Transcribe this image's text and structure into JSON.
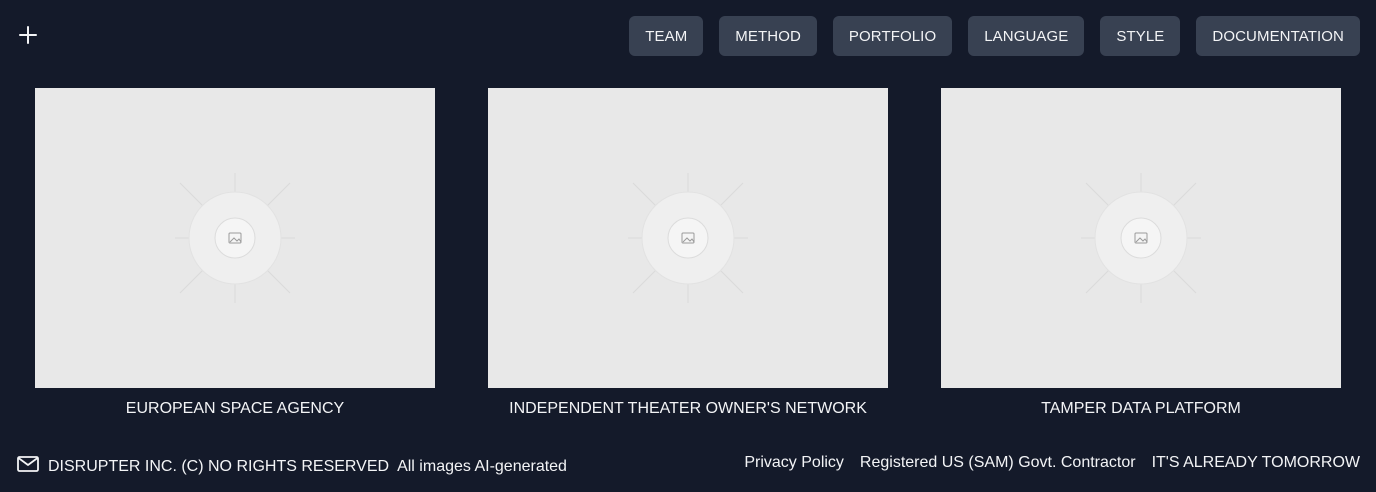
{
  "header": {
    "add_icon": "plus-icon",
    "nav": [
      {
        "label": "TEAM"
      },
      {
        "label": "METHOD"
      },
      {
        "label": "PORTFOLIO"
      },
      {
        "label": "LANGUAGE"
      },
      {
        "label": "STYLE"
      },
      {
        "label": "DOCUMENTATION"
      }
    ]
  },
  "portfolio": {
    "items": [
      {
        "caption": "EUROPEAN SPACE AGENCY",
        "image_icon": "image-placeholder-icon"
      },
      {
        "caption": "INDEPENDENT THEATER OWNER'S NETWORK",
        "image_icon": "image-placeholder-icon"
      },
      {
        "caption": "TAMPER DATA PLATFORM",
        "image_icon": "image-placeholder-icon"
      }
    ]
  },
  "footer": {
    "mail_icon": "mail-icon",
    "copyright": "DISRUPTER INC. (C) NO RIGHTS RESERVED",
    "ai_note": "All images AI-generated",
    "links": [
      {
        "label": "Privacy Policy"
      },
      {
        "label": "Registered US (SAM) Govt. Contractor"
      },
      {
        "label": "IT'S ALREADY TOMORROW"
      }
    ]
  },
  "colors": {
    "background": "#141a2a",
    "nav_button": "#384152",
    "text": "#f3f4f6",
    "placeholder": "#e8e8e8"
  }
}
